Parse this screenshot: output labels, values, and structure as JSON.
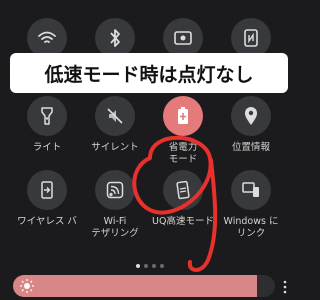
{
  "banner": {
    "text": "低速モード時は点灯なし"
  },
  "tiles_row2": [
    {
      "label": "ライト",
      "icon": "flashlight-icon"
    },
    {
      "label": "サイレント",
      "icon": "mute-icon"
    },
    {
      "label": "省電力\nモード",
      "icon": "battery-saver-icon",
      "active": true
    },
    {
      "label": "位置情報",
      "icon": "location-icon"
    }
  ],
  "tiles_row3": [
    {
      "label": "ワイヤレス バ",
      "icon": "wireless-powershare-icon"
    },
    {
      "label": "Wi-Fi\nテザリング",
      "icon": "wifi-tethering-icon"
    },
    {
      "label": "UQ高速モード",
      "icon": "uq-speed-icon"
    },
    {
      "label": "Windows に\nリンク",
      "icon": "link-to-windows-icon"
    }
  ],
  "top_row_icons": [
    "wifi-icon",
    "bluetooth-icon",
    "screen-record-icon",
    "nfc-icon"
  ],
  "page_indicator": {
    "count": 4,
    "current": 0
  },
  "brightness": {
    "level": 0.93
  },
  "colors": {
    "accent": "#e47a7a",
    "annotation": "#e8312c",
    "background": "#1b1b1d"
  }
}
